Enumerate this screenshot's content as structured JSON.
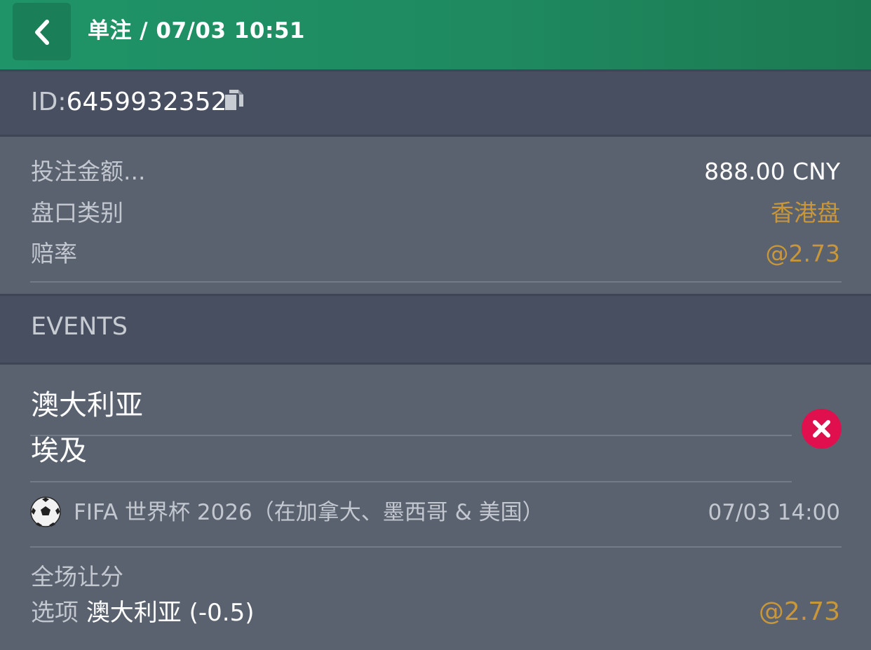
{
  "header": {
    "back_icon": "chevron-left-icon",
    "title": "单注 / 07/03 10:51"
  },
  "bet_id": {
    "label": "ID:",
    "value": "6459932352",
    "copy_icon": "copy-icon"
  },
  "summary": {
    "rows": [
      {
        "label": "投注金额...",
        "value": "888.00 CNY"
      },
      {
        "label": "盘口类别",
        "value": "香港盘"
      },
      {
        "label": "赔率",
        "value": "@2.73"
      }
    ]
  },
  "events": {
    "section_label": "EVENTS",
    "home_team": "澳大利亚",
    "away_team": "埃及",
    "remove_icon": "close-circle-icon",
    "sport_icon": "soccer-ball-icon",
    "league": "FIFA 世界杯 2026（在加拿大、墨西哥 & 美国）",
    "time": "07/03 14:00",
    "market": "全场让分",
    "selection_label": "选项",
    "selection_value": "澳大利亚 (-0.5)",
    "odds": "@2.73"
  },
  "colors": {
    "header_green": "#1f8a60",
    "background": "#5a6270",
    "bar": "#484f60",
    "gold": "#c9973a",
    "remove_red": "#e0104f"
  }
}
